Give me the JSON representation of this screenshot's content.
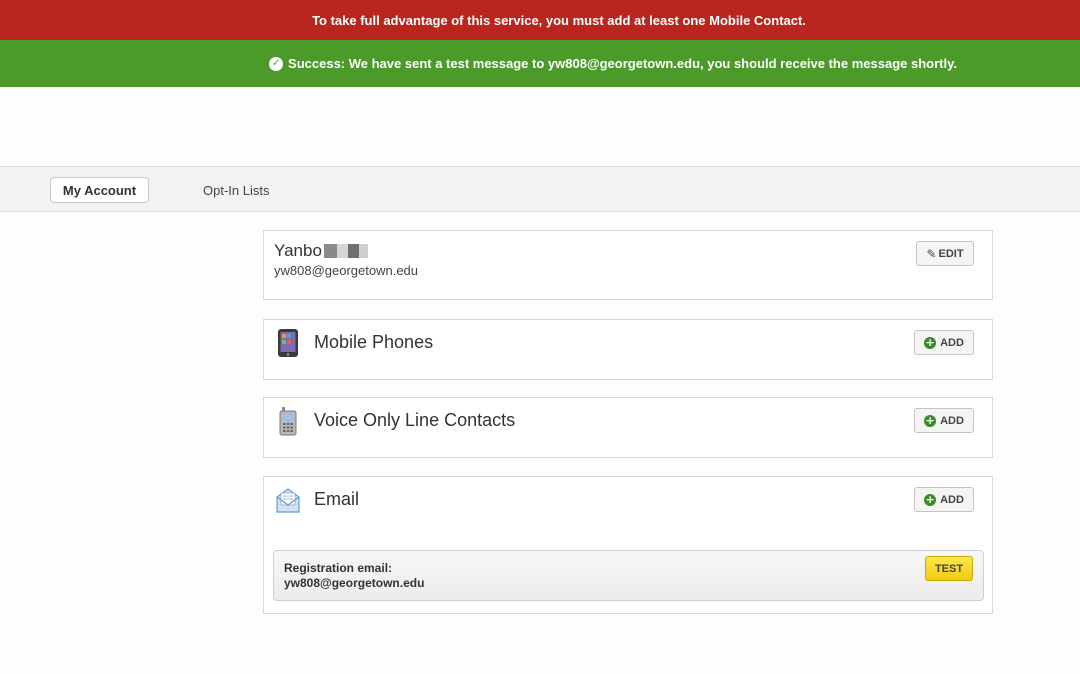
{
  "banners": {
    "warning": "To take full advantage of this service, you must add at least one Mobile Contact.",
    "success": "Success: We have sent a test message to yw808@georgetown.edu, you should receive the message shortly.",
    "success_icon": "check-circle-icon"
  },
  "nav": {
    "tabs": [
      {
        "label": "My Account",
        "active": true
      },
      {
        "label": "Opt-In Lists",
        "active": false
      }
    ]
  },
  "account": {
    "name": "Yanbo",
    "email": "yw808@georgetown.edu",
    "edit_label": "EDIT"
  },
  "sections": {
    "mobile": {
      "title": "Mobile Phones",
      "add_label": "ADD",
      "icon": "smartphone-icon"
    },
    "voice": {
      "title": "Voice Only Line Contacts",
      "add_label": "ADD",
      "icon": "cell-phone-icon"
    },
    "email": {
      "title": "Email",
      "add_label": "ADD",
      "icon": "envelope-icon",
      "registration_label": "Registration email:",
      "registration_email": "yw808@georgetown.edu",
      "test_label": "TEST"
    }
  },
  "colors": {
    "warning_bg": "#b8261d",
    "success_bg": "#4c9a2a",
    "test_button": "#f2cc12"
  }
}
